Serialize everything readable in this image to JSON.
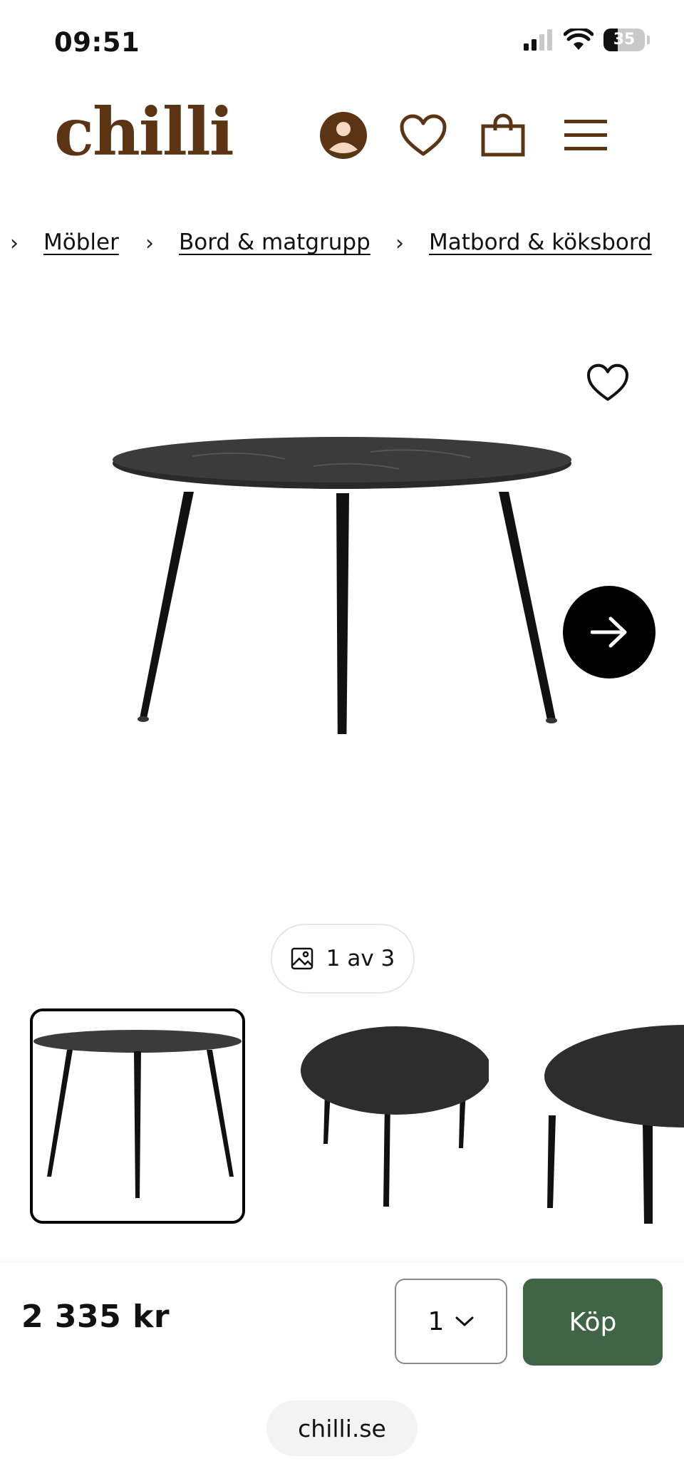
{
  "status_bar": {
    "time": "09:51",
    "battery_percent": 35,
    "battery_label": "35"
  },
  "header": {
    "logo_text": "chilli",
    "icons": [
      "account-icon",
      "heart-icon",
      "bag-icon",
      "menu-icon"
    ]
  },
  "breadcrumb": {
    "separator": "›",
    "items": [
      "Möbler",
      "Bord & matgrupp",
      "Matbord & köksbord"
    ]
  },
  "gallery": {
    "counter_text": "1 av 3",
    "current_image": 1,
    "total_images": 3
  },
  "buy_bar": {
    "price": "2 335 kr",
    "quantity": "1",
    "buy_label": "Köp"
  },
  "browser": {
    "url": "chilli.se"
  },
  "colors": {
    "brand": "#5b3414",
    "buy_button": "#3f6446",
    "text": "#111111"
  }
}
